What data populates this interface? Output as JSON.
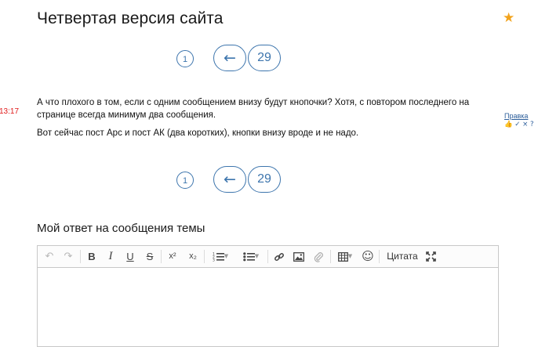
{
  "page": {
    "title": "Четвертая версия сайта",
    "favorite_icon": "star-icon"
  },
  "pagination": {
    "first": "1",
    "prev": "←",
    "last": "29"
  },
  "post": {
    "time": "13:17",
    "paragraphs": [
      "А что плохого в том, если с одним сообщением  внизу будут кнопочки? Хотя, с повтором последнего на странице всегда минимум два сообщения.",
      "Вот сейчас пост Арс и пост АК (два коротких), кнопки внизу вроде и не надо."
    ],
    "edit_link": "Правка",
    "actions": {
      "like": "👍",
      "check": "✓",
      "close": "×",
      "question": "?"
    }
  },
  "reply": {
    "title": "Мой ответ на сообщения темы",
    "toolbar": {
      "undo": "↶",
      "redo": "↷",
      "bold": "B",
      "italic": "I",
      "underline": "U",
      "strike": "S",
      "superscript": "x²",
      "subscript": "x₂",
      "caret": "▼",
      "quote_label": "Цитата",
      "emoji": "☺"
    }
  }
}
